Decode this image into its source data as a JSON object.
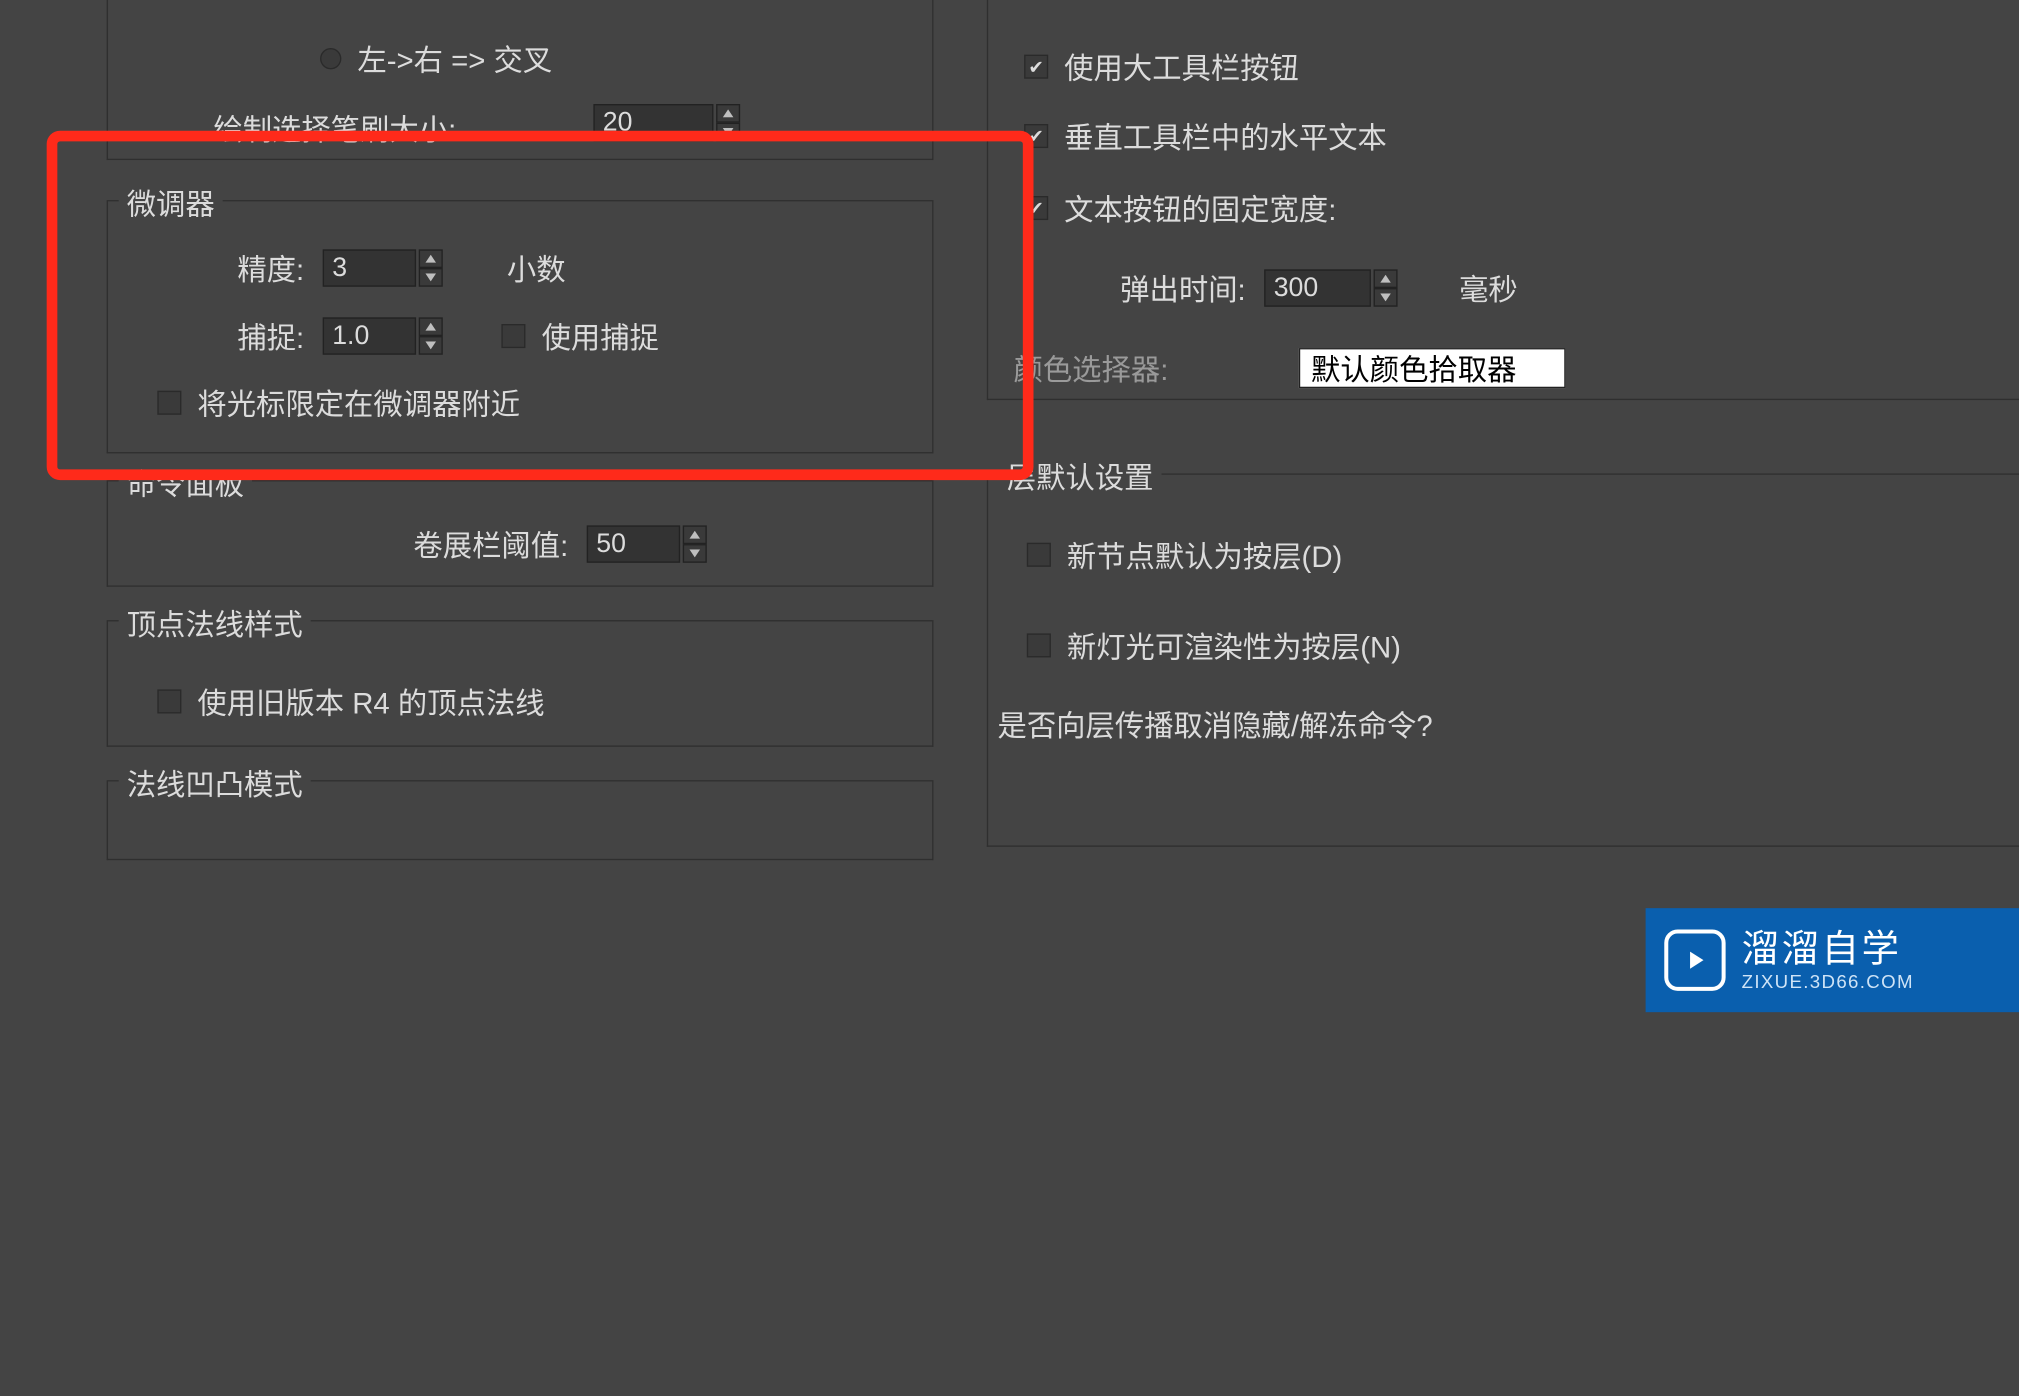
{
  "top_radio_label": "左->右 => 交叉",
  "brush_size_label": "绘制选择笔刷大小:",
  "brush_size_value": "20",
  "spinner_group": {
    "title": "微调器",
    "precision_label": "精度:",
    "precision_value": "3",
    "precision_unit": "小数",
    "snap_label": "捕捉:",
    "snap_value": "1.0",
    "use_snap_label": "使用捕捉",
    "lock_cursor_label": "将光标限定在微调器附近"
  },
  "command_panel": {
    "title": "命令面板",
    "rollout_threshold_label": "卷展栏阈值:",
    "rollout_threshold_value": "50"
  },
  "vertex_normal": {
    "title": "顶点法线样式",
    "legacy_r4_label": "使用旧版本 R4 的顶点法线"
  },
  "normal_bump_title": "法线凹凸模式",
  "right_panel": {
    "large_toolbar_label": "使用大工具栏按钮",
    "horiz_text_label": "垂直工具栏中的水平文本",
    "fixed_width_label": "文本按钮的固定宽度:",
    "flyout_time_label": "弹出时间:",
    "flyout_time_value": "300",
    "flyout_time_unit": "毫秒",
    "color_picker_label": "颜色选择器:",
    "color_picker_value": "默认颜色拾取器"
  },
  "layer_defaults": {
    "title": "层默认设置",
    "new_node_label": "新节点默认为按层(D)",
    "new_light_label": "新灯光可渲染性为按层(N)",
    "propagate_label": "是否向层传播取消隐藏/解冻命令?"
  },
  "watermark": {
    "line1": "溜溜自学",
    "line2": "ZIXUE.3D66.COM"
  }
}
